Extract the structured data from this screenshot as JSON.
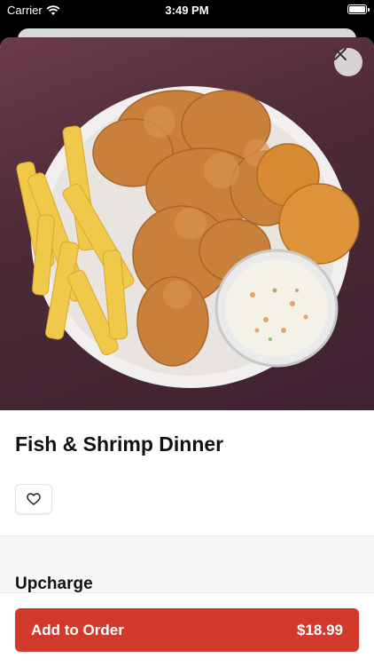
{
  "status_bar": {
    "carrier": "Carrier",
    "time": "3:49 PM"
  },
  "item": {
    "image_description": "fried fish and shrimp with fries, hushpuppies and coleslaw",
    "title": "Fish & Shrimp Dinner"
  },
  "section": {
    "title": "Upcharge"
  },
  "footer": {
    "add_label": "Add to Order",
    "price": "$18.99"
  },
  "colors": {
    "accent": "#d33a2c"
  },
  "icons": {
    "close": "close-icon",
    "favorite": "heart-icon",
    "wifi": "wifi-icon",
    "battery": "battery-icon"
  }
}
